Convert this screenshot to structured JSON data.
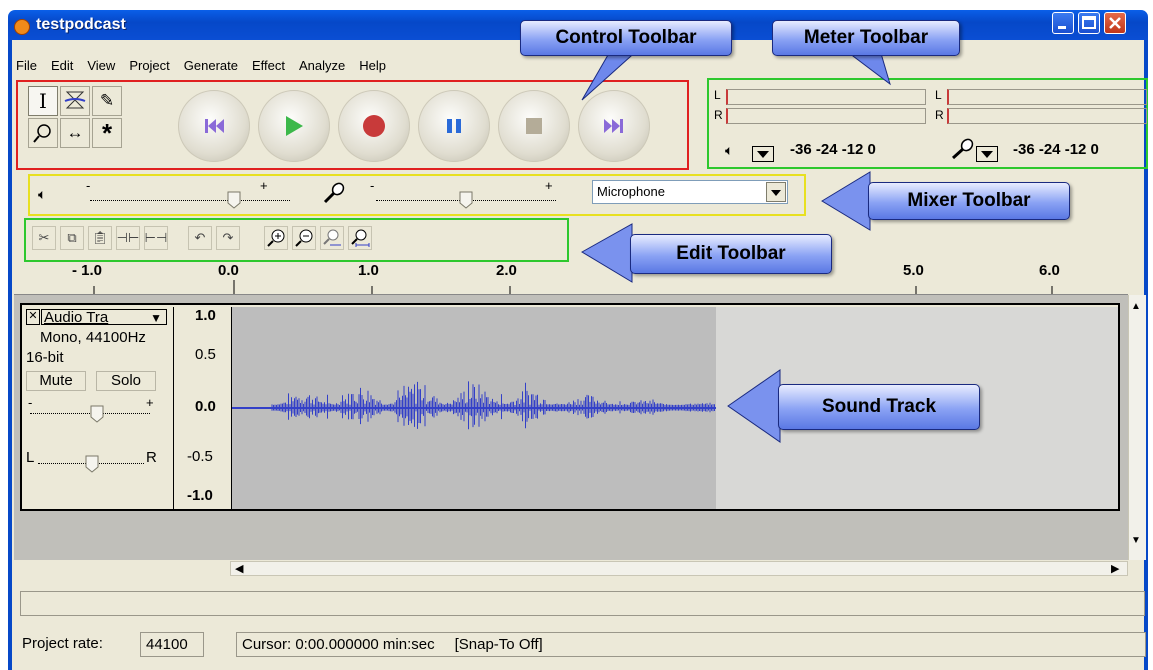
{
  "window": {
    "title": "testpodcast",
    "controls": [
      "minimize",
      "maximize",
      "close"
    ]
  },
  "menu": [
    "File",
    "Edit",
    "View",
    "Project",
    "Generate",
    "Effect",
    "Analyze",
    "Help"
  ],
  "tools": [
    "selection-tool-icon",
    "envelope-tool-icon",
    "draw-tool-icon",
    "zoom-tool-icon",
    "time-shift-tool-icon",
    "multi-tool-icon"
  ],
  "control_buttons": [
    "skip-to-start-icon",
    "play-icon",
    "record-icon",
    "pause-icon",
    "stop-icon",
    "skip-to-end-icon"
  ],
  "meter": {
    "left_label": "L",
    "right_label": "R",
    "playback_scale": "-36 -24 -12 0",
    "record_scale": "-36 -24 -12 0"
  },
  "mixer": {
    "input_source": "Microphone",
    "minus": "-",
    "plus": "+",
    "output_volume": 0.72,
    "input_volume": 0.5
  },
  "ruler": {
    "ticks": [
      "- 1.0",
      "0.0",
      "1.0",
      "2.0",
      "5.0",
      "6.0"
    ]
  },
  "track": {
    "name": "Audio Tra",
    "format": "Mono, 44100Hz",
    "bitdepth": "16-bit",
    "mute_label": "Mute",
    "solo_label": "Solo",
    "pan_left": "L",
    "pan_right": "R",
    "gain_minus": "-",
    "gain_plus": "+",
    "scale": [
      "1.0",
      "0.5",
      "0.0",
      "-0.5",
      "-1.0"
    ]
  },
  "status": {
    "project_rate_label": "Project rate:",
    "project_rate_value": "44100",
    "cursor_text": "Cursor: 0:00.000000 min:sec",
    "snap_text": "[Snap-To Off]"
  },
  "annotations": {
    "control": "Control Toolbar",
    "meter": "Meter Toolbar",
    "mixer": "Mixer Toolbar",
    "edit": "Edit Toolbar",
    "sound": "Sound Track"
  },
  "colors": {
    "waveform": "#3340c8",
    "control_box": "#e02020",
    "meter_box": "#2ec82e",
    "mixer_box": "#e8e020",
    "edit_box": "#2ec82e"
  }
}
